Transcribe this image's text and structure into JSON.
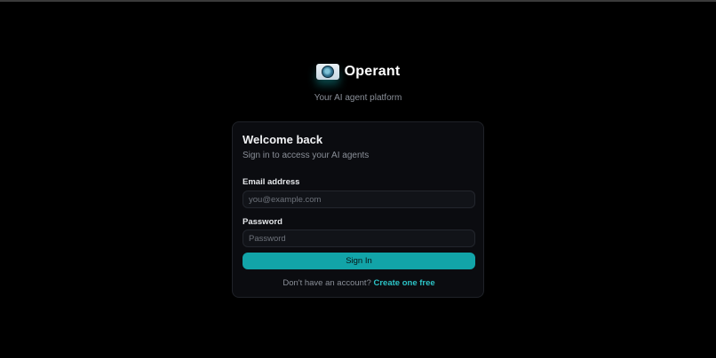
{
  "brand": {
    "name": "Operant",
    "tagline": "Your AI agent platform",
    "logo_icon": "eye-logo-icon"
  },
  "login_card": {
    "title": "Welcome back",
    "subtitle": "Sign in to access your AI agents",
    "email": {
      "label": "Email address",
      "placeholder": "you@example.com",
      "value": ""
    },
    "password": {
      "label": "Password",
      "placeholder": "Password",
      "value": ""
    },
    "submit_label": "Sign In",
    "signup_prompt": "Don't have an account?",
    "signup_link": "Create one free"
  },
  "colors": {
    "background": "#000000",
    "card": "#0b0c10",
    "accent": "#12a4a8",
    "link": "#2cc3c6"
  }
}
